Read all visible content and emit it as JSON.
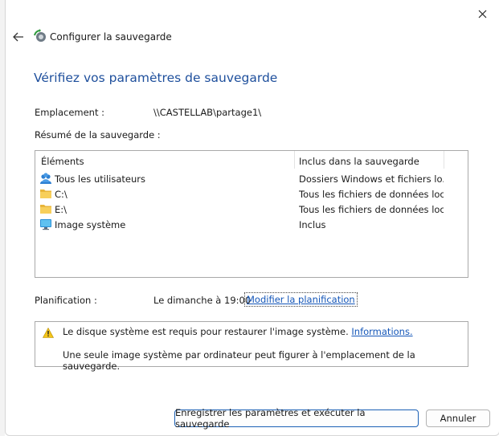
{
  "window": {
    "title": "Configurer la sauvegarde"
  },
  "heading": "Vérifiez vos paramètres de sauvegarde",
  "location": {
    "label": "Emplacement :",
    "value": "\\\\CASTELLAB\\partage1\\"
  },
  "summary_label": "Résumé de la sauvegarde :",
  "table": {
    "columns": [
      "Éléments",
      "Inclus dans la sauvegarde"
    ],
    "rows": [
      {
        "name": "Tous les utilisateurs",
        "included": "Dossiers Windows et fichiers lo...",
        "icon": "users-icon"
      },
      {
        "name": "C:\\",
        "included": "Tous les fichiers de données loc...",
        "icon": "folder-icon"
      },
      {
        "name": "E:\\",
        "included": "Tous les fichiers de données loc...",
        "icon": "folder-icon"
      },
      {
        "name": "Image système",
        "included": "Inclus",
        "icon": "monitor-icon"
      }
    ]
  },
  "schedule": {
    "label": "Planification :",
    "value": "Le dimanche à 19:00",
    "link": "Modifier la planification"
  },
  "warning": {
    "text": "Le disque système est requis pour restaurer l'image système.",
    "link": "Informations.",
    "note": "Une seule image système par ordinateur peut figurer à l'emplacement de la sauvegarde."
  },
  "buttons": {
    "save": "Enregistrer les paramètres et exécuter la sauvegarde",
    "cancel": "Annuler"
  },
  "colors": {
    "heading": "#1e4f9c",
    "link": "#1456b8",
    "primary_border": "#1a5fb4"
  }
}
